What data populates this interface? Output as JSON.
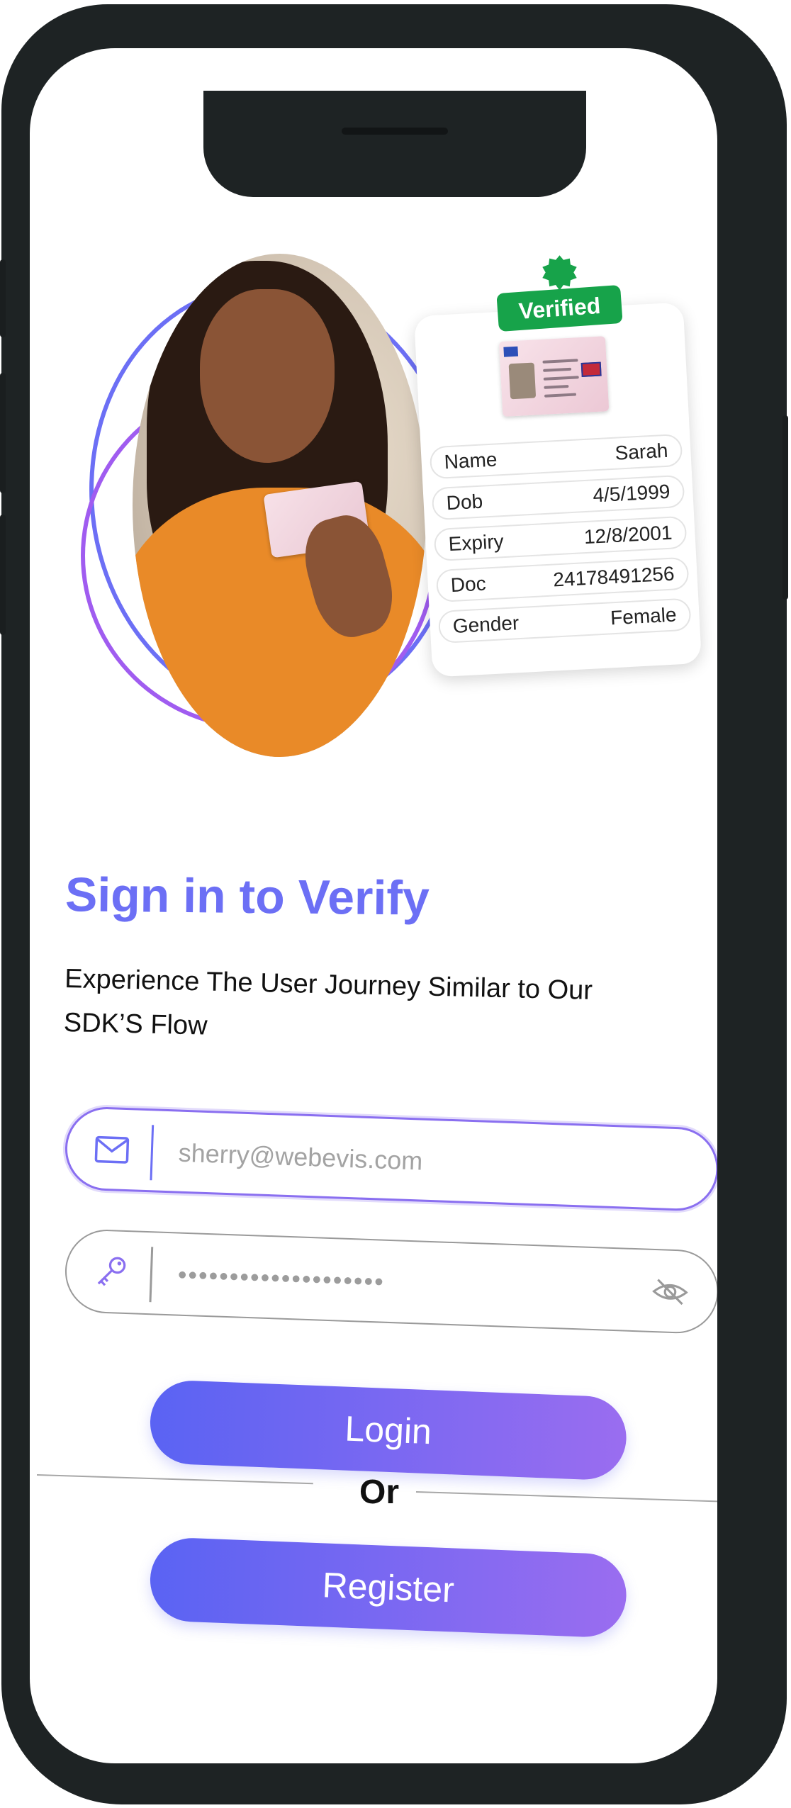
{
  "verified_card": {
    "badge": "Verified",
    "rows": [
      {
        "label": "Name",
        "value": "Sarah"
      },
      {
        "label": "Dob",
        "value": "4/5/1999"
      },
      {
        "label": "Expiry",
        "value": "12/8/2001"
      },
      {
        "label": "Doc",
        "value": "24178491256"
      },
      {
        "label": "Gender",
        "value": "Female"
      }
    ]
  },
  "form": {
    "title": "Sign in to Verify",
    "subtitle": "Experience The User Journey Similar to Our SDK’S Flow",
    "email_placeholder": "sherry@webevis.com",
    "password_value": "••••••••••••••••••••",
    "login_label": "Login",
    "or_label": "Or",
    "register_label": "Register"
  },
  "colors": {
    "accent": "#6c6ff5",
    "button_gradient_start": "#5a63f3",
    "button_gradient_end": "#9a6df0",
    "verified_green": "#17a34a"
  },
  "icons": [
    "envelope-icon",
    "key-icon",
    "eye-slash-icon",
    "verified-seal-icon"
  ]
}
